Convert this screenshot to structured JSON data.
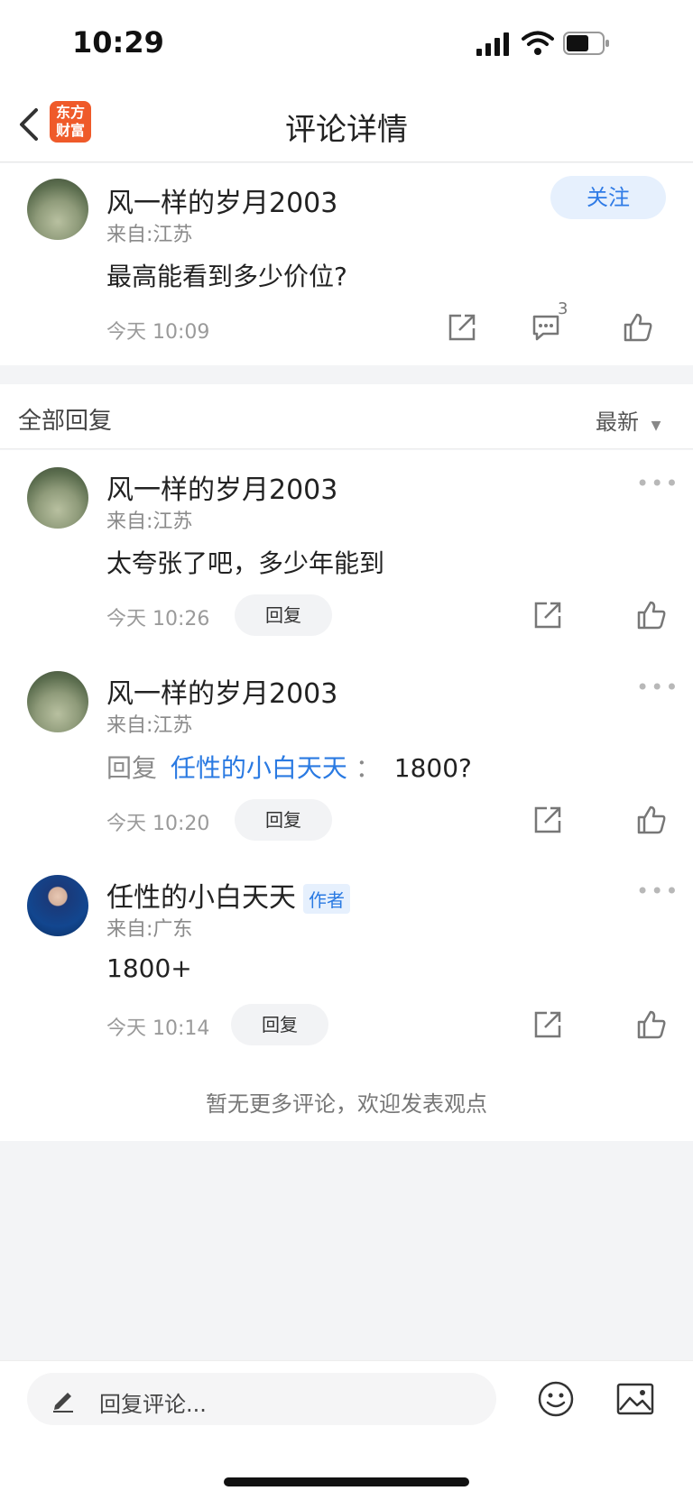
{
  "status": {
    "time": "10:29"
  },
  "nav": {
    "logo_line1": "东方",
    "logo_line2": "财富",
    "title": "评论详情"
  },
  "post": {
    "user": "风一样的岁月2003",
    "from": "来自:江苏",
    "follow_label": "关注",
    "content": "最高能看到多少价位?",
    "time": "今天 10:09",
    "comment_count": "3"
  },
  "section": {
    "title": "全部回复",
    "sort_label": "最新"
  },
  "replies": [
    {
      "user": "风一样的岁月2003",
      "from": "来自:江苏",
      "content": "太夸张了吧，多少年能到",
      "time": "今天 10:26",
      "reply_label": "回复"
    },
    {
      "user": "风一样的岁月2003",
      "from": "来自:江苏",
      "reply_prefix": "回复",
      "reply_to": "任性的小白天天",
      "reply_sep": "：",
      "content": "1800?",
      "time": "今天 10:20",
      "reply_label": "回复"
    },
    {
      "user": "任性的小白天天",
      "tag": "作者",
      "from": "来自:广东",
      "content": "1800+",
      "time": "今天 10:14",
      "reply_label": "回复"
    }
  ],
  "footer_note": "暂无更多评论，欢迎发表观点",
  "input": {
    "placeholder": "回复评论..."
  },
  "icons": {
    "back": "chevron-left-icon",
    "share": "share-icon",
    "comment": "comment-icon",
    "like": "thumbs-up-icon",
    "more": "more-dots-icon",
    "edit": "pencil-icon",
    "emoji": "emoji-icon",
    "image": "image-icon"
  }
}
